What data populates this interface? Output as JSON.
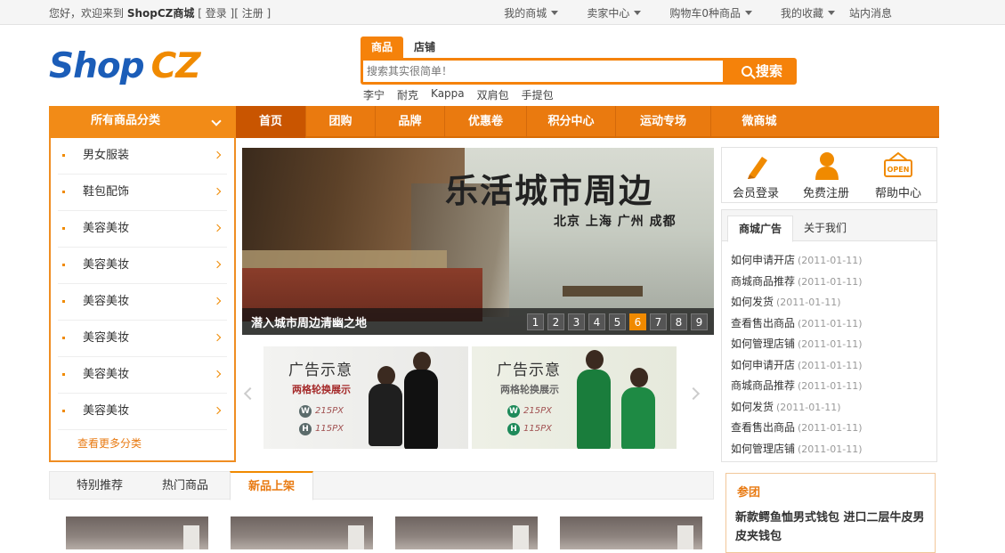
{
  "topbar": {
    "welcome_prefix": "您好，欢迎来到",
    "site_name": "ShopCZ商城",
    "login": "[ 登录 ]",
    "register": "[ 注册 ]",
    "links": [
      "我的商城",
      "卖家中心",
      "购物车0种商品",
      "我的收藏",
      "站内消息"
    ]
  },
  "logo": {
    "part1": "Shop",
    "part2": "CZ"
  },
  "search": {
    "tabs": [
      "商品",
      "店铺"
    ],
    "placeholder": "搜索其实很简单！",
    "button": "搜索",
    "hot_keywords": [
      "李宁",
      "耐克",
      "Kappa",
      "双肩包",
      "手提包"
    ]
  },
  "nav": {
    "all_categories": "所有商品分类",
    "items": [
      "首页",
      "团购",
      "品牌",
      "优惠卷",
      "积分中心",
      "运动专场",
      "微商城"
    ]
  },
  "categories": {
    "items": [
      "男女服装",
      "鞋包配饰",
      "美容美妆",
      "美容美妆",
      "美容美妆",
      "美容美妆",
      "美容美妆",
      "美容美妆"
    ],
    "more": "查看更多分类"
  },
  "banner": {
    "title": "乐活城市周边",
    "cities": "北京  上海  广州 成都",
    "caption": "潜入城市周边清幽之地",
    "pages": [
      "1",
      "2",
      "3",
      "4",
      "5",
      "6",
      "7",
      "8",
      "9"
    ],
    "active_page": "6"
  },
  "ads": [
    {
      "title": "广告示意",
      "subtitle": "两格轮换展示",
      "w": "215PX",
      "h": "115PX",
      "w_letter": "W",
      "h_letter": "H"
    },
    {
      "title": "广告示意",
      "subtitle": "两格轮换展示",
      "w": "215PX",
      "h": "115PX",
      "w_letter": "W",
      "h_letter": "H"
    }
  ],
  "user_links": [
    "会员登录",
    "免费注册",
    "帮助中心"
  ],
  "open_sign": "OPEN",
  "news": {
    "tabs": [
      "商城广告",
      "关于我们"
    ],
    "items": [
      {
        "title": "如何申请开店",
        "date": "(2011-01-11)"
      },
      {
        "title": "商城商品推荐",
        "date": "(2011-01-11)"
      },
      {
        "title": "如何发货",
        "date": "(2011-01-11)"
      },
      {
        "title": "查看售出商品",
        "date": "(2011-01-11)"
      },
      {
        "title": "如何管理店铺",
        "date": "(2011-01-11)"
      },
      {
        "title": "如何申请开店",
        "date": "(2011-01-11)"
      },
      {
        "title": "商城商品推荐",
        "date": "(2011-01-11)"
      },
      {
        "title": "如何发货",
        "date": "(2011-01-11)"
      },
      {
        "title": "查看售出商品",
        "date": "(2011-01-11)"
      },
      {
        "title": "如何管理店铺",
        "date": "(2011-01-11)"
      }
    ]
  },
  "product_tabs": [
    "特别推荐",
    "热门商品",
    "新品上架"
  ],
  "group_buy": {
    "heading": "参团",
    "title": "新款鳄鱼恤男式钱包 进口二层牛皮男皮夹钱包"
  },
  "colors": {
    "accent": "#f08a00",
    "nav": "#ea7a0f",
    "brand_blue": "#1b5db8"
  }
}
